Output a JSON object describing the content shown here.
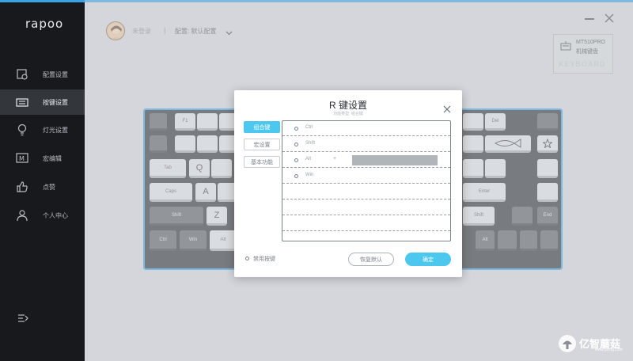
{
  "app": {
    "logo": "rapoo"
  },
  "sidebar": {
    "items": [
      {
        "label": "配置设置",
        "icon": "settings-device-icon"
      },
      {
        "label": "按键设置",
        "icon": "keyboard-icon",
        "active": true
      },
      {
        "label": "灯光设置",
        "icon": "lightbulb-icon"
      },
      {
        "label": "宏编辑",
        "icon": "macro-icon"
      },
      {
        "label": "点赞",
        "icon": "thumbs-up-icon"
      },
      {
        "label": "个人中心",
        "icon": "user-icon"
      }
    ],
    "collapse_icon": "collapse-menu-icon"
  },
  "header": {
    "user_name": "未登录",
    "separator": "|",
    "profile": "配置: 默认配置",
    "device_model": "MT510PRO",
    "device_sub": "机械键盘",
    "device_word": "KEYBOARD"
  },
  "keyboard": {
    "keys": [
      "F1",
      "Tab",
      "Q",
      "Caps",
      "A",
      "Shift",
      "Z",
      "Ctrl",
      "Win",
      "Alt",
      "Del",
      "Enter",
      "Shift",
      "End",
      "Alt"
    ]
  },
  "dialog": {
    "title": "R 键设置",
    "subtitle": "功能类型: 组合键",
    "categories": [
      {
        "label": "组合键",
        "active": true
      },
      {
        "label": "宏设置",
        "active": false
      },
      {
        "label": "基本功能",
        "active": false
      }
    ],
    "options": [
      {
        "label": "Ctrl"
      },
      {
        "label": "Shift"
      },
      {
        "label": "Alt",
        "plus": "+"
      },
      {
        "label": "Win"
      }
    ],
    "footer_option": "禁用按键",
    "restore_button": "恢复默认",
    "confirm_button": "确定"
  },
  "watermark": {
    "text": "亿智蘑菇",
    "url": "www.yzmg.com"
  },
  "colors": {
    "accent": "#4cc7ee",
    "sidebar_bg": "#17191c",
    "top_bar": "#3aa3e6"
  }
}
